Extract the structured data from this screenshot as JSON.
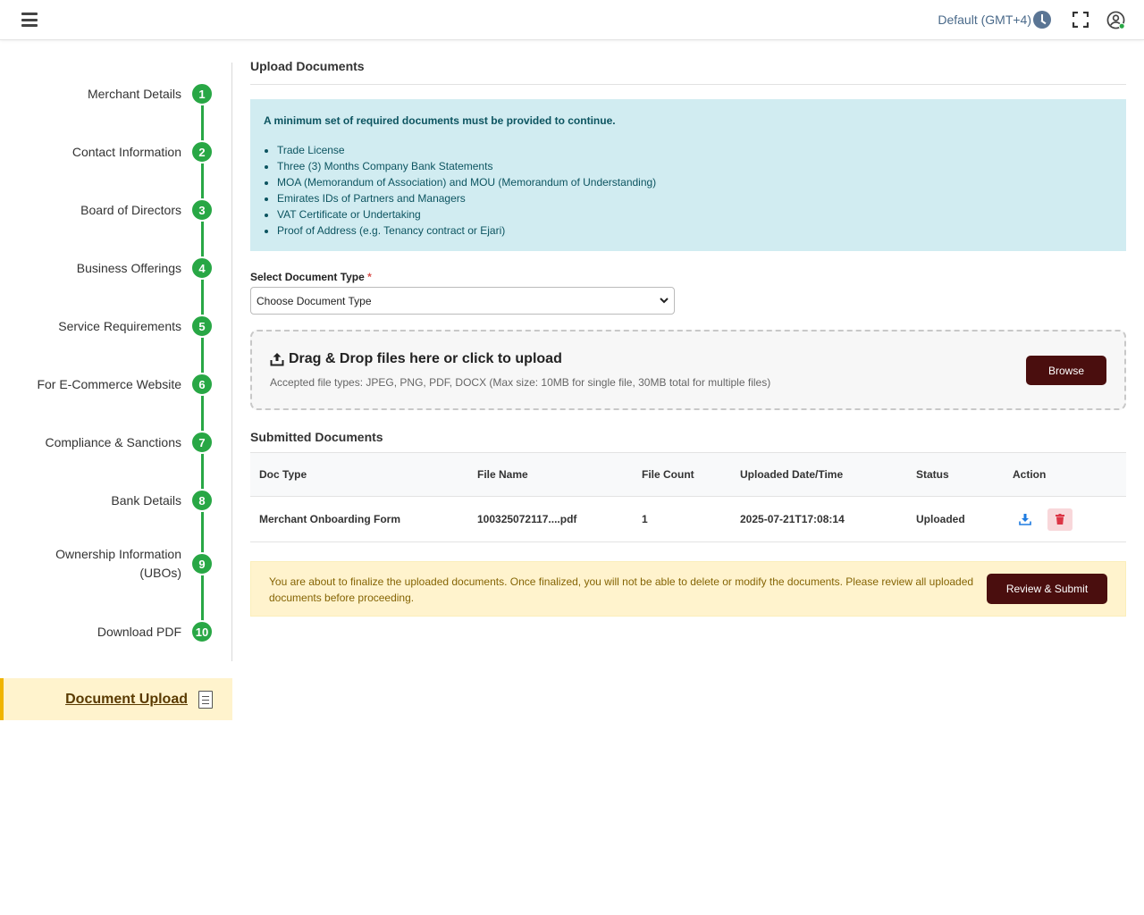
{
  "header": {
    "timezone": "Default (GMT+4)",
    "icons": [
      "hamburger-menu-icon",
      "clock-icon",
      "fullscreen-icon",
      "user-account-icon"
    ]
  },
  "stepper": {
    "steps": [
      {
        "number": "1",
        "label": "Merchant Details"
      },
      {
        "number": "2",
        "label": "Contact Information"
      },
      {
        "number": "3",
        "label": "Board of Directors"
      },
      {
        "number": "4",
        "label": "Business Offerings"
      },
      {
        "number": "5",
        "label": "Service Requirements"
      },
      {
        "number": "6",
        "label": "For E-Commerce Website"
      },
      {
        "number": "7",
        "label": "Compliance & Sanctions"
      },
      {
        "number": "8",
        "label": "Bank Details"
      },
      {
        "number": "9",
        "label_line1": "Ownership Information",
        "label_line2": "(UBOs)"
      },
      {
        "number": "10",
        "label": "Download PDF"
      }
    ],
    "active_item": "Document Upload",
    "step_color": "#28a745"
  },
  "main": {
    "title": "Upload Documents",
    "info": {
      "title": "A minimum set of required documents must be provided to continue.",
      "items": [
        "Trade License",
        "Three (3) Months Company Bank Statements",
        "MOA (Memorandum of Association) and MOU (Memorandum of Understanding)",
        "Emirates IDs of Partners and Managers",
        "VAT Certificate or Undertaking",
        "Proof of Address (e.g. Tenancy contract or Ejari)"
      ]
    },
    "select": {
      "label": "Select Document Type",
      "required_mark": "*",
      "value": "Choose Document Type"
    },
    "dropzone": {
      "title": "Drag & Drop files here or click to upload",
      "subtitle": "Accepted file types: JPEG, PNG, PDF, DOCX (Max size: 10MB for single file, 30MB total for multiple files)",
      "browse_label": "Browse"
    },
    "submitted": {
      "title": "Submitted Documents",
      "columns": [
        "Doc Type",
        "File Name",
        "File Count",
        "Uploaded Date/Time",
        "Status",
        "Action"
      ],
      "rows": [
        {
          "doc_type": "Merchant Onboarding Form",
          "file_name": "100325072117....pdf",
          "file_count": "1",
          "uploaded": "2025-07-21T17:08:14",
          "status": "Uploaded"
        }
      ]
    },
    "warning": {
      "text": "You are about to finalize the uploaded documents. Once finalized, you will not be able to delete or modify the documents. Please review all uploaded documents before proceeding.",
      "submit_label": "Review & Submit"
    }
  }
}
